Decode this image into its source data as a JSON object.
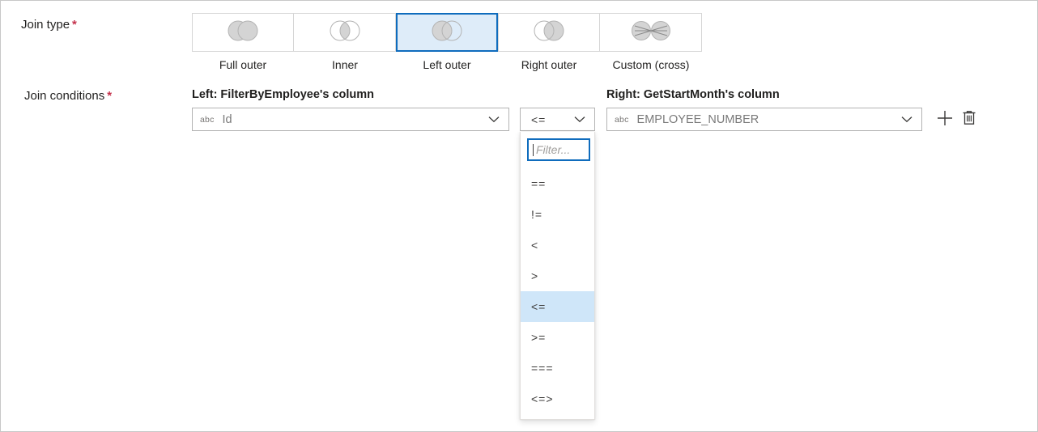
{
  "form": {
    "join_type_label": "Join type",
    "join_conditions_label": "Join conditions",
    "required_marker": "*"
  },
  "join_types": [
    {
      "id": "full-outer",
      "label": "Full outer",
      "icon": "venn-full-outer-icon",
      "selected": false
    },
    {
      "id": "inner",
      "label": "Inner",
      "icon": "venn-inner-icon",
      "selected": false
    },
    {
      "id": "left-outer",
      "label": "Left outer",
      "icon": "venn-left-outer-icon",
      "selected": true
    },
    {
      "id": "right-outer",
      "label": "Right outer",
      "icon": "venn-right-outer-icon",
      "selected": false
    },
    {
      "id": "custom-cross",
      "label": "Custom (cross)",
      "icon": "venn-custom-cross-icon",
      "selected": false
    }
  ],
  "condition": {
    "left_header": "Left: FilterByEmployee's column",
    "right_header": "Right: GetStartMonth's column",
    "left_column": {
      "type_badge": "abc",
      "value": "Id"
    },
    "right_column": {
      "type_badge": "abc",
      "value": "EMPLOYEE_NUMBER"
    },
    "operator": {
      "value": "<="
    },
    "add_icon": "plus-icon",
    "delete_icon": "trash-icon"
  },
  "operator_dropdown": {
    "open": true,
    "filter_placeholder": "Filter...",
    "options": [
      {
        "label": "==",
        "selected": false
      },
      {
        "label": "!=",
        "selected": false
      },
      {
        "label": "<",
        "selected": false
      },
      {
        "label": ">",
        "selected": false
      },
      {
        "label": "<=",
        "selected": true
      },
      {
        "label": ">=",
        "selected": false
      },
      {
        "label": "===",
        "selected": false
      },
      {
        "label": "<=>",
        "selected": false
      }
    ]
  },
  "colors": {
    "accent": "#0f6cbd",
    "selected_tile_bg": "#deecf9",
    "highlight_row": "#cfe6f9",
    "required_star": "#c4314b",
    "venn_fill": "#d4d4d4",
    "venn_stroke": "#b3b3b3"
  }
}
